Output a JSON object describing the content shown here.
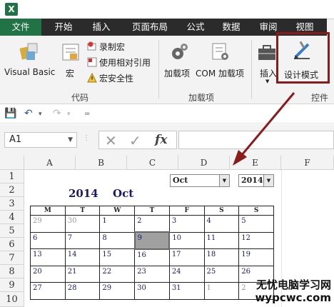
{
  "app": {
    "logo_letter": "X"
  },
  "tabs": [
    {
      "label": "文件"
    },
    {
      "label": "开始"
    },
    {
      "label": "插入"
    },
    {
      "label": "页面布局"
    },
    {
      "label": "公式"
    },
    {
      "label": "数据"
    },
    {
      "label": "审阅"
    },
    {
      "label": "视图"
    }
  ],
  "ribbon": {
    "code_group": {
      "label": "代码",
      "visual_basic": "Visual Basic",
      "macros": "宏",
      "record_macro": "录制宏",
      "relative_ref": "使用相对引用",
      "macro_security": "宏安全性"
    },
    "addins_group": {
      "label": "加载项",
      "addins": "加载项",
      "com_addins": "COM 加载项"
    },
    "controls_group": {
      "label": "控件",
      "insert": "插入",
      "design_mode": "设计模式"
    }
  },
  "formula_bar": {
    "name_box": "A1",
    "fx": "fx"
  },
  "grid": {
    "columns": [
      "A",
      "B",
      "C",
      "D",
      "E",
      "F"
    ],
    "rows": [
      "1",
      "2",
      "3",
      "4",
      "5",
      "6",
      "7",
      "8",
      "9",
      "10"
    ]
  },
  "calendar": {
    "year_title": "2014",
    "month_title": "Oct",
    "month_select": "Oct",
    "year_select": "2014",
    "weekdays": [
      "M",
      "T",
      "W",
      "T",
      "F",
      "S",
      "S"
    ],
    "weeks": [
      [
        "29",
        "30",
        "1",
        "2",
        "3",
        "4",
        "5"
      ],
      [
        "6",
        "7",
        "8",
        "9",
        "10",
        "11",
        "12"
      ],
      [
        "13",
        "14",
        "15",
        "16",
        "17",
        "18",
        "19"
      ],
      [
        "20",
        "21",
        "22",
        "23",
        "24",
        "25",
        "26"
      ],
      [
        "27",
        "28",
        "29",
        "30",
        "31",
        "1",
        "2"
      ]
    ],
    "selected_day": "9"
  },
  "watermark": {
    "line1": "无忧电脑学习网",
    "line2": "wypcwc.com"
  },
  "colors": {
    "file_tab": "#217346",
    "tabbar": "#2b2b2b",
    "highlight": "#8b1a1a"
  }
}
